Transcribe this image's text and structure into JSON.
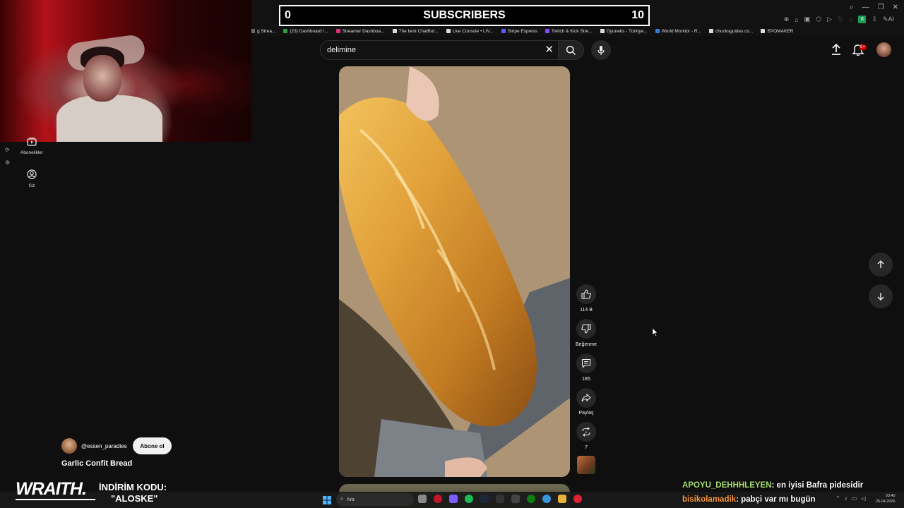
{
  "overlay": {
    "counter_left": "0",
    "counter_title": "SUBSCRIBERS",
    "counter_right": "10"
  },
  "bookmarks": [
    {
      "label": "g Strea...",
      "color": "#6b6b6b"
    },
    {
      "label": "(23) Dashboard /...",
      "color": "#2f9e44"
    },
    {
      "label": "Streamer Dashboa...",
      "color": "#e0317a"
    },
    {
      "label": "The best ChatBot...",
      "color": "#dddddd"
    },
    {
      "label": "Live Console • LIV...",
      "color": "#dddddd"
    },
    {
      "label": "Stripe Express",
      "color": "#635bff"
    },
    {
      "label": "Twitch & Kick Stre...",
      "color": "#9146ff"
    },
    {
      "label": "Oyuneks - Türkiye...",
      "color": "#dddddd"
    },
    {
      "label": "World Monitor - R...",
      "color": "#3a7bd5"
    },
    {
      "label": "chucksguides.co...",
      "color": "#dddddd"
    },
    {
      "label": "EPOMAKER",
      "color": "#dddddd"
    }
  ],
  "nav": {
    "subscriptions": "Abonelikler",
    "you": "Siz"
  },
  "search": {
    "value": "delimine"
  },
  "header": {
    "notification_count": "9+"
  },
  "actions": {
    "like_count": "114 B",
    "dislike_label": "Beğenme",
    "comment_count": "185",
    "share_label": "Paylaş",
    "remix_count": "7"
  },
  "video": {
    "channel": "@essen_paradies",
    "subscribe_label": "Abone ol",
    "title": "Garlic Confit Bread"
  },
  "sponsor": {
    "logo": "WRAITH.",
    "promo_label": "İNDİRİM KODU:",
    "promo_code": "\"ALOSKE\""
  },
  "chat": [
    {
      "user": "APOYU_DEHHHLEYEN",
      "message": ": en iyisi Bafra pidesidir",
      "user_color": "#a8e070"
    },
    {
      "user": "bisikolamadik",
      "message": ": pabçi var mı bugün",
      "user_color": "#ff9a3c"
    }
  ],
  "taskbar": {
    "search_placeholder": "Ara",
    "time": "03:40",
    "date": "26.04.2026"
  },
  "colors": {
    "background": "#0f0f0f",
    "notification_badge": "#cc0000",
    "surface": "#272727"
  }
}
